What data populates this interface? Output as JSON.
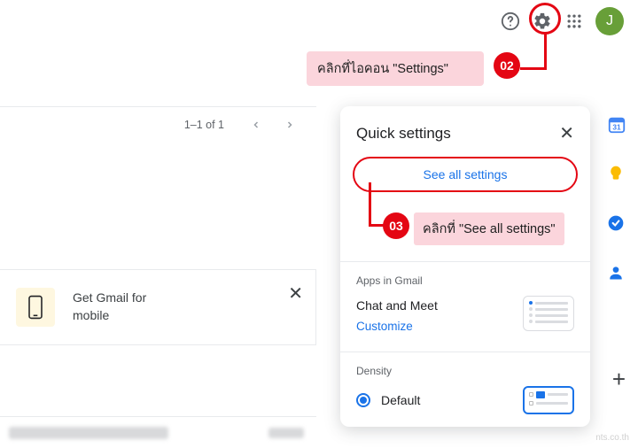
{
  "header": {
    "avatar_letter": "J"
  },
  "annotations": {
    "step02": {
      "label": "คลิกที่ไอคอน \"Settings\"",
      "badge": "02"
    },
    "step03": {
      "label": "คลิกที่ \"See all settings\"",
      "badge": "03"
    }
  },
  "mail_list": {
    "pager_text": "1–1 of 1"
  },
  "promo": {
    "text": "Get Gmail for mobile"
  },
  "quick_settings": {
    "title": "Quick settings",
    "see_all_label": "See all settings",
    "sections": {
      "apps": {
        "label": "Apps in Gmail",
        "row_title": "Chat and Meet",
        "customize": "Customize"
      },
      "density": {
        "label": "Density",
        "options": [
          "Default"
        ],
        "selected": "Default"
      }
    }
  },
  "watermark": "nts.co.th"
}
